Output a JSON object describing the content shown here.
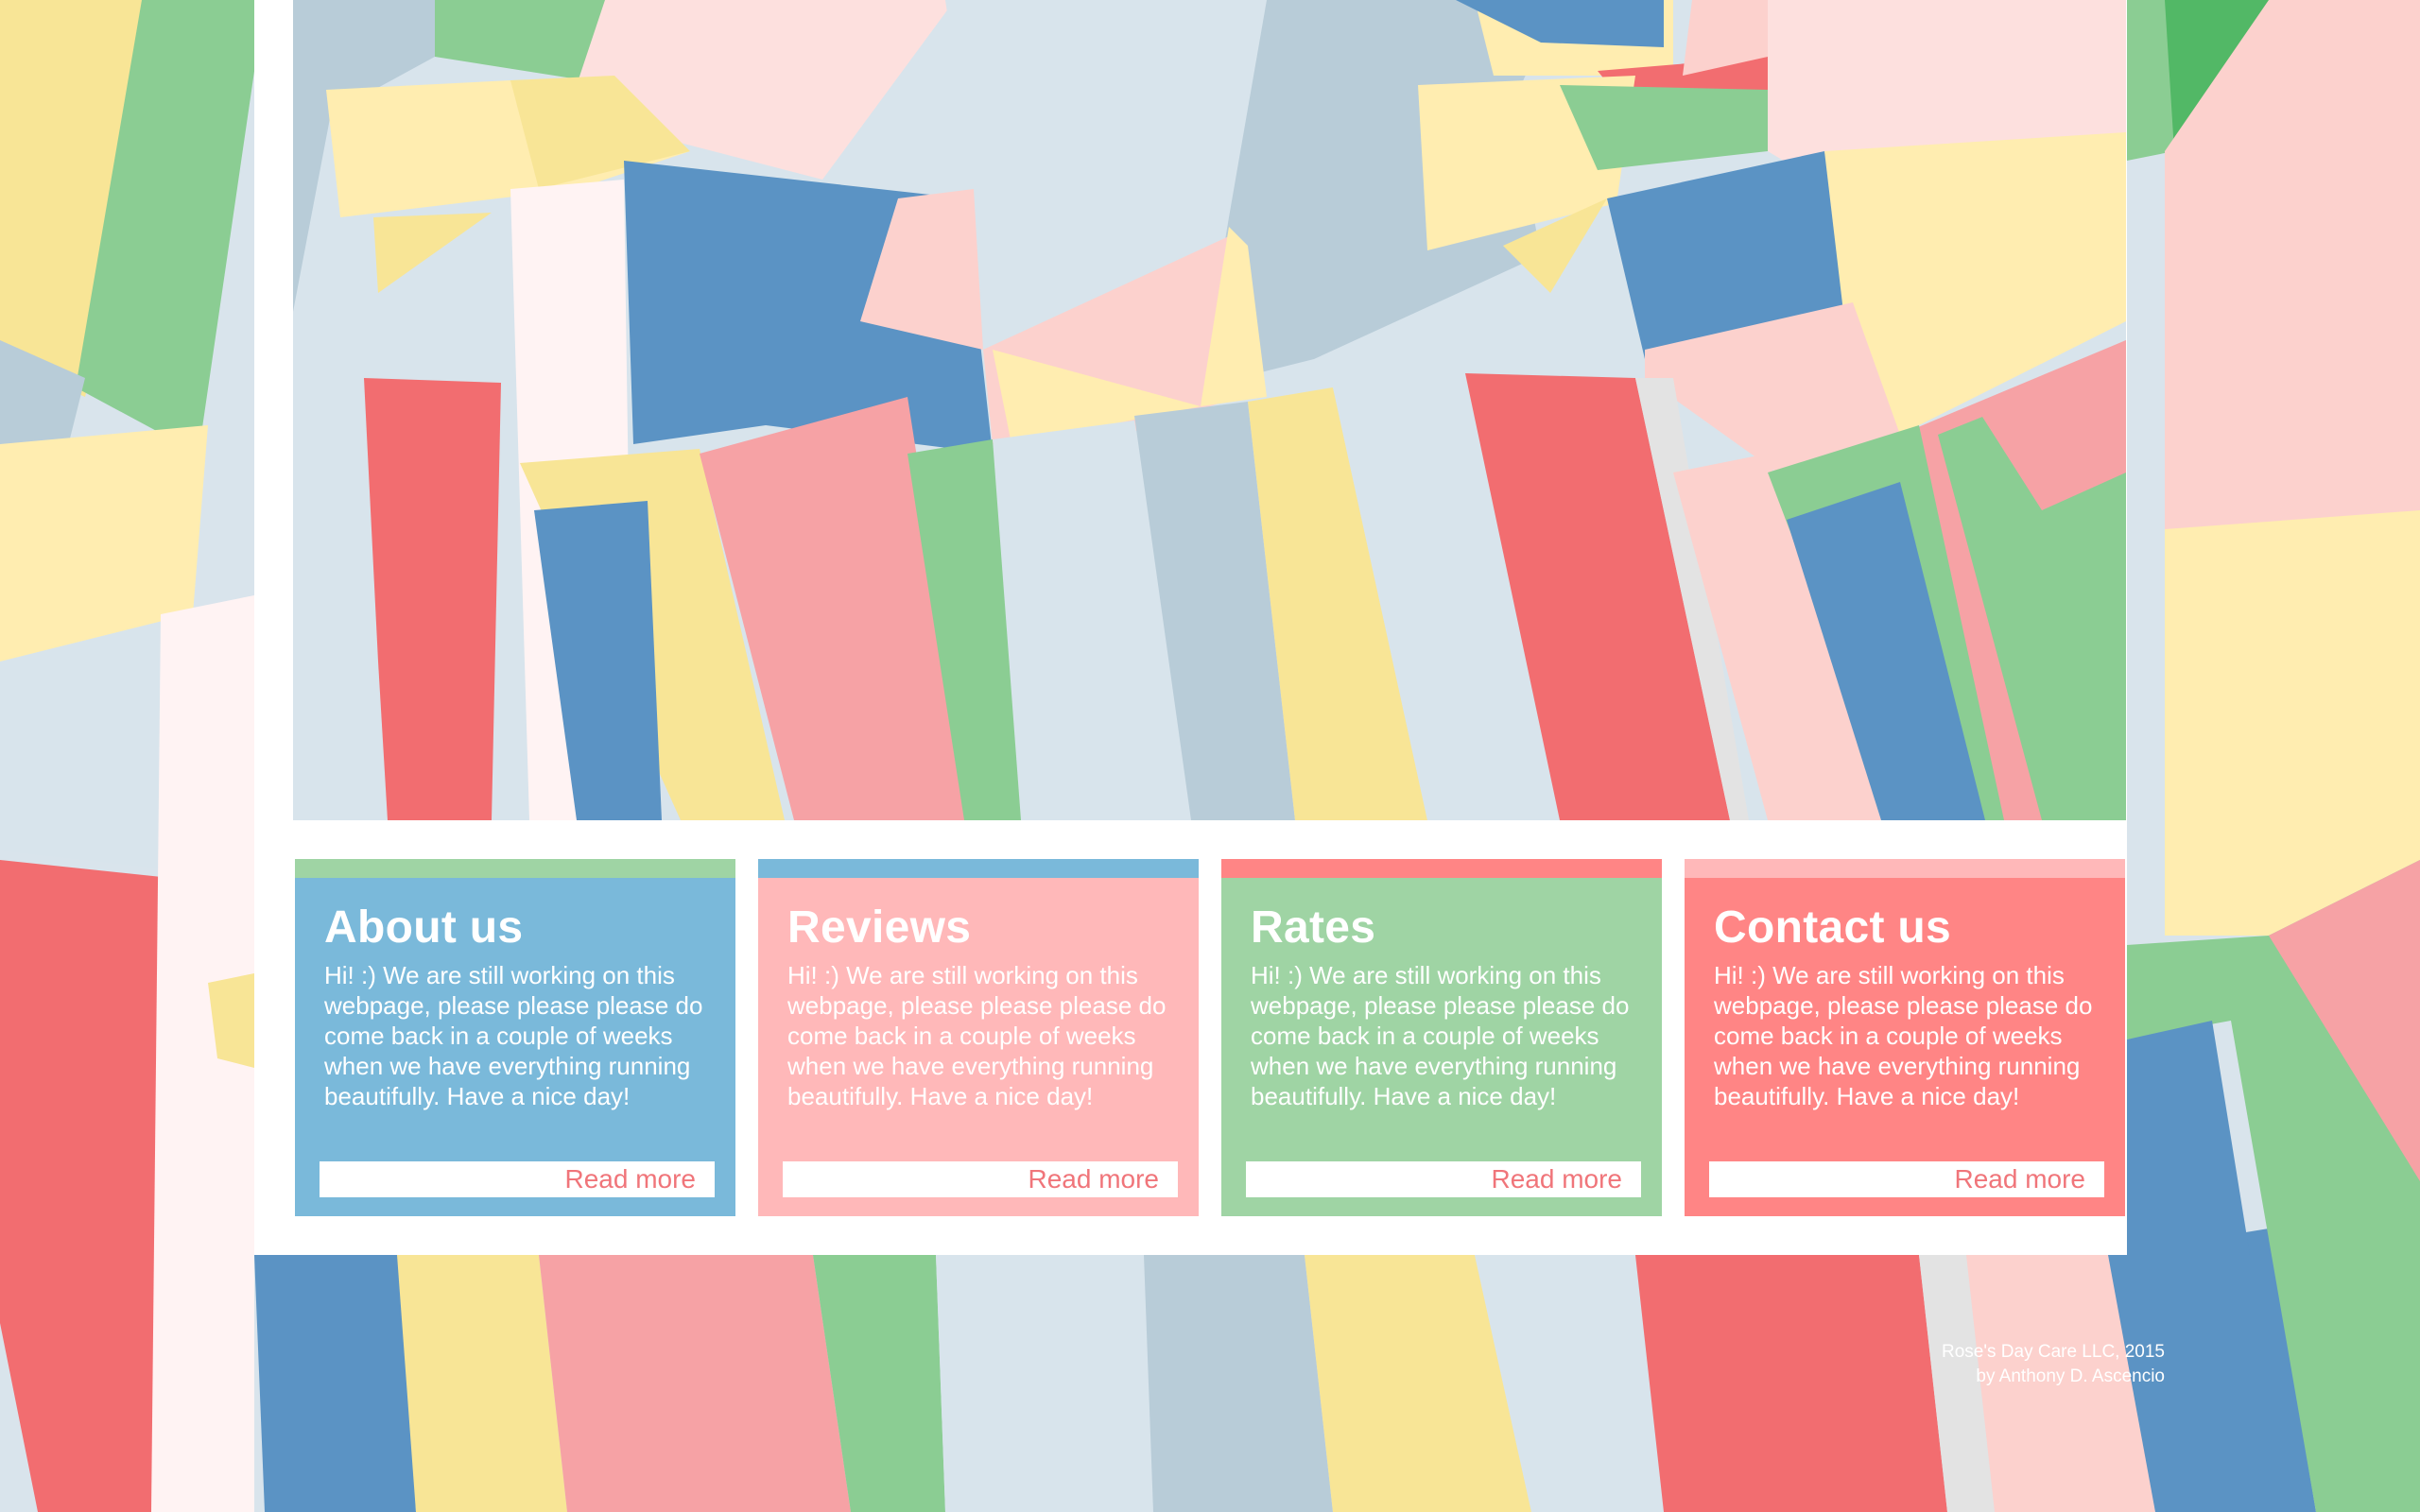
{
  "cards": [
    {
      "title": "About us",
      "body": "Hi! :) We are still working on this webpage, please please please do come back in a couple of weeks when we have everything running beautifully. Have a nice day!",
      "link": "Read more",
      "bg_color": "#7ab9da",
      "stripe_color": "#9fd4a4"
    },
    {
      "title": "Reviews",
      "body": "Hi! :) We are still working on this webpage, please please please do come back in a couple of weeks when we have everything running beautifully. Have a nice day!",
      "link": "Read more",
      "bg_color": "#ffb8b9",
      "stripe_color": "#7ab9da"
    },
    {
      "title": "Rates",
      "body": "Hi! :) We are still working on this webpage, please please please do come back in a couple of weeks when we have everything running beautifully. Have a nice day!",
      "link": "Read more",
      "bg_color": "#9fd4a4",
      "stripe_color": "#ff8585"
    },
    {
      "title": "Contact us",
      "body": "Hi! :) We are still working on this webpage, please please please do come back in a couple of weeks when we have everything running beautifully. Have a nice day!",
      "link": "Read more",
      "bg_color": "#ff8585",
      "stripe_color": "#ffb8b9"
    }
  ],
  "footer": {
    "line1": "Rose's Day Care LLC, 2015",
    "line2": "by Anthony D. Ascencio"
  },
  "palette": {
    "blue": "#5b93c4",
    "red": "#f26d70",
    "pink": "#f6a2a5",
    "light_pink": "#fcd1cd",
    "green": "#8bcd93",
    "yellow": "#f8e596",
    "light_yellow": "#ffedb0",
    "gray_blue": "#b8ccd8",
    "light_gray_blue": "#d8e4ec"
  }
}
